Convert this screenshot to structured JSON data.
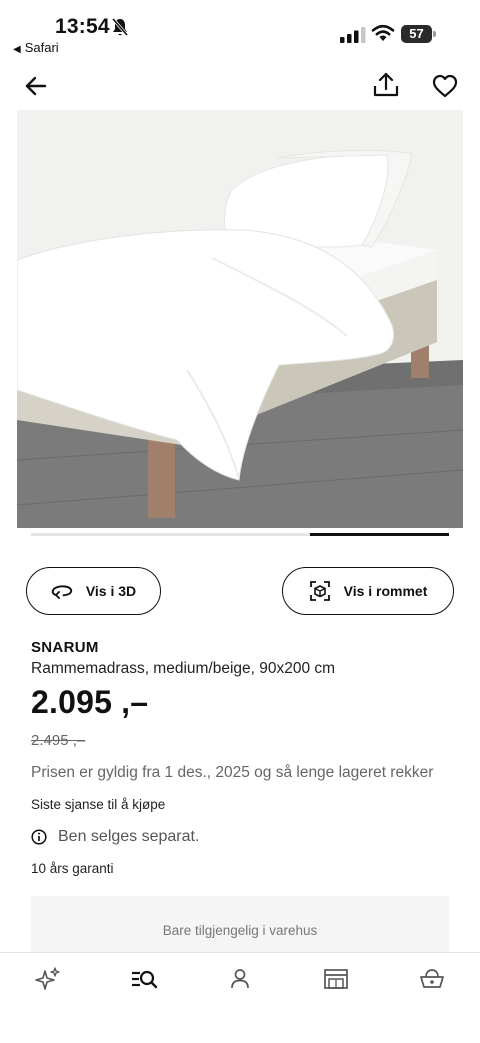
{
  "status_bar": {
    "time": "13:54",
    "back_app": "Safari",
    "battery": "57",
    "icons": [
      "bell-slash-icon",
      "cellular-signal-icon",
      "wifi-icon",
      "battery-icon"
    ]
  },
  "nav": {
    "icons": [
      "back-arrow-icon",
      "share-icon",
      "heart-icon"
    ]
  },
  "gallery": {
    "image_subject": "bed-photo",
    "pager_active_index": 3,
    "pager_count": 3
  },
  "actions": {
    "view_3d_label": "Vis i 3D",
    "view_in_room_label": "Vis i rommet"
  },
  "product": {
    "name": "SNARUM",
    "description": "Rammemadrass, medium/beige, 90x200 cm",
    "price": "2.095 ,–",
    "old_price": "2.495 ,–",
    "validity": "Prisen er gyldig fra 1 des., 2025 og så lenge lageret rekker",
    "last_chance": "Siste sjanse til å kjøpe",
    "info_note": "Ben selges separat.",
    "warranty": "10 års garanti",
    "availability": "Bare tilgjengelig i varehus"
  },
  "tab_bar": {
    "tabs": [
      "sparkle-icon",
      "search-list-icon",
      "person-icon",
      "store-icon",
      "basket-icon"
    ],
    "active_tab": "search-list-icon"
  },
  "colors": {
    "text": "#111111",
    "muted": "#666666",
    "availability_bg": "#f5f5f5",
    "divider": "#e2e2e2"
  }
}
